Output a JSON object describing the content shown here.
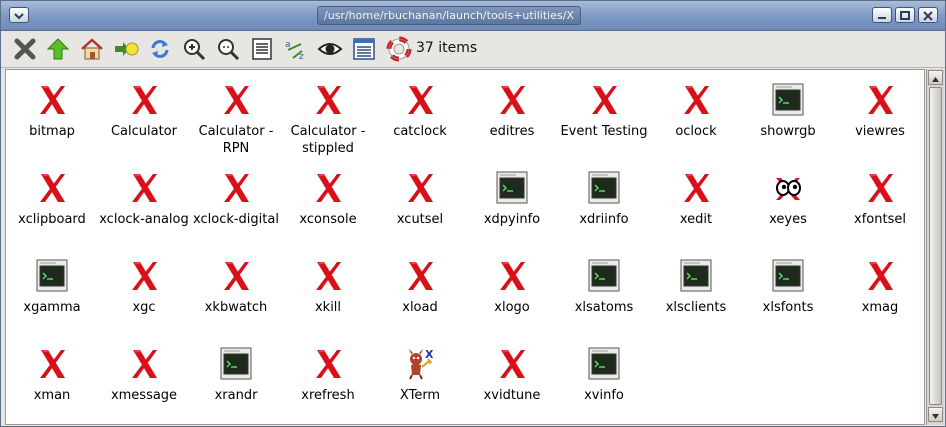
{
  "window": {
    "title": "/usr/home/rbuchanan/launch/tools+utilities/X"
  },
  "toolbar": {
    "tools": [
      {
        "icon": "close-x-icon"
      },
      {
        "icon": "up-arrow-icon"
      },
      {
        "icon": "home-icon"
      },
      {
        "icon": "bookmark-icon"
      },
      {
        "icon": "refresh-icon"
      },
      {
        "icon": "zoom-in-icon"
      },
      {
        "icon": "zoom-out-icon"
      },
      {
        "icon": "details-view-icon"
      },
      {
        "icon": "sort-az-icon"
      },
      {
        "icon": "eye-icon"
      },
      {
        "icon": "list-view-icon"
      },
      {
        "icon": "help-lifebuoy-icon"
      }
    ],
    "item_count": "37 items"
  },
  "items": [
    {
      "label": "bitmap",
      "icon": "x-icon"
    },
    {
      "label": "Calculator",
      "icon": "x-icon"
    },
    {
      "label": "Calculator - RPN",
      "icon": "x-icon"
    },
    {
      "label": "Calculator - stippled",
      "icon": "x-icon"
    },
    {
      "label": "catclock",
      "icon": "x-icon"
    },
    {
      "label": "editres",
      "icon": "x-icon"
    },
    {
      "label": "Event Testing",
      "icon": "x-icon"
    },
    {
      "label": "oclock",
      "icon": "x-icon"
    },
    {
      "label": "showrgb",
      "icon": "terminal-icon"
    },
    {
      "label": "viewres",
      "icon": "x-icon"
    },
    {
      "label": "xclipboard",
      "icon": "x-icon"
    },
    {
      "label": "xclock-analog",
      "icon": "x-icon"
    },
    {
      "label": "xclock-digital",
      "icon": "x-icon"
    },
    {
      "label": "xconsole",
      "icon": "x-icon"
    },
    {
      "label": "xcutsel",
      "icon": "x-icon"
    },
    {
      "label": "xdpyinfo",
      "icon": "terminal-icon"
    },
    {
      "label": "xdriinfo",
      "icon": "terminal-icon"
    },
    {
      "label": "xedit",
      "icon": "x-icon"
    },
    {
      "label": "xeyes",
      "icon": "xeyes-icon"
    },
    {
      "label": "xfontsel",
      "icon": "x-icon"
    },
    {
      "label": "xgamma",
      "icon": "terminal-icon"
    },
    {
      "label": "xgc",
      "icon": "x-icon"
    },
    {
      "label": "xkbwatch",
      "icon": "x-icon"
    },
    {
      "label": "xkill",
      "icon": "x-icon"
    },
    {
      "label": "xload",
      "icon": "x-icon"
    },
    {
      "label": "xlogo",
      "icon": "x-icon"
    },
    {
      "label": "xlsatoms",
      "icon": "terminal-icon"
    },
    {
      "label": "xlsclients",
      "icon": "terminal-icon"
    },
    {
      "label": "xlsfonts",
      "icon": "terminal-icon"
    },
    {
      "label": "xmag",
      "icon": "x-icon"
    },
    {
      "label": "xman",
      "icon": "x-icon"
    },
    {
      "label": "xmessage",
      "icon": "x-icon"
    },
    {
      "label": "xrandr",
      "icon": "terminal-icon"
    },
    {
      "label": "xrefresh",
      "icon": "x-icon"
    },
    {
      "label": "XTerm",
      "icon": "xterm-devil-icon"
    },
    {
      "label": "xvidtune",
      "icon": "x-icon"
    },
    {
      "label": "xvinfo",
      "icon": "terminal-icon"
    }
  ],
  "colors": {
    "x_red": "#d8101a",
    "titlebar": "#7e98c3",
    "terminal_screen": "#1d2a1d",
    "terminal_text": "#5fd35f"
  }
}
